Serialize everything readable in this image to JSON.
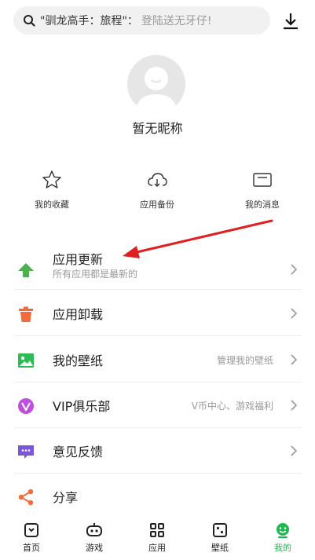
{
  "search": {
    "query": "\"驯龙高手：旅程\"：",
    "hint": "登陆送无牙仔!"
  },
  "profile": {
    "nickname": "暂无昵称"
  },
  "quick_actions": [
    {
      "label": "我的收藏",
      "icon": "star-icon"
    },
    {
      "label": "应用备份",
      "icon": "cloud-backup-icon"
    },
    {
      "label": "我的消息",
      "icon": "message-icon"
    }
  ],
  "menu": [
    {
      "title": "应用更新",
      "subtitle": "所有应用都是最新的",
      "extra": "",
      "icon": "update-arrow-icon",
      "color": "#4caf50"
    },
    {
      "title": "应用卸载",
      "subtitle": "",
      "extra": "",
      "icon": "trash-icon",
      "color": "#f26b3a"
    },
    {
      "title": "我的壁纸",
      "subtitle": "",
      "extra": "管理我的壁纸",
      "icon": "wallpaper-icon",
      "color": "#2dbb54"
    },
    {
      "title": "VIP俱乐部",
      "subtitle": "",
      "extra": "V币中心、游戏福利",
      "icon": "vip-icon",
      "color": "#c04fe0"
    },
    {
      "title": "意见反馈",
      "subtitle": "",
      "extra": "",
      "icon": "feedback-icon",
      "color": "#7a56d8"
    },
    {
      "title": "分享",
      "subtitle": "",
      "extra": "",
      "icon": "share-icon",
      "color": "#f26b3a"
    }
  ],
  "nav": [
    {
      "label": "首页",
      "icon": "home-icon",
      "active": false
    },
    {
      "label": "游戏",
      "icon": "gamepad-icon",
      "active": false
    },
    {
      "label": "应用",
      "icon": "apps-icon",
      "active": false
    },
    {
      "label": "壁纸",
      "icon": "wallpaper-nav-icon",
      "active": false
    },
    {
      "label": "我的",
      "icon": "profile-icon",
      "active": true
    }
  ],
  "colors": {
    "accent_green": "#1fb84e",
    "annotation_arrow": "#e02020"
  }
}
